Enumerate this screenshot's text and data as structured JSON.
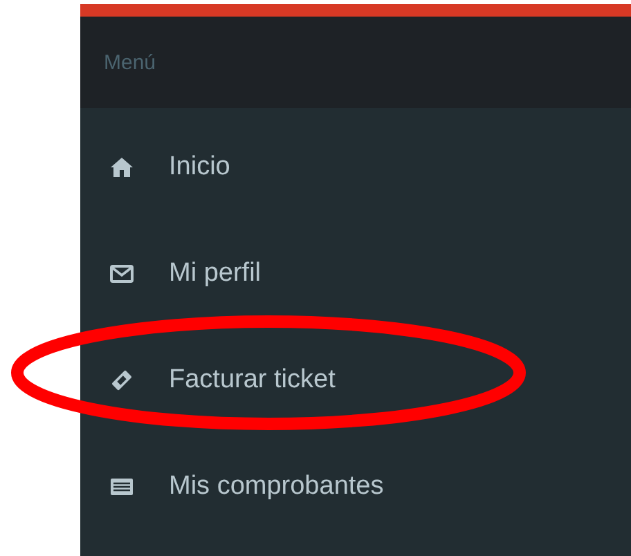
{
  "sidebar": {
    "header": "Menú",
    "items": [
      {
        "label": "Inicio",
        "circled": false
      },
      {
        "label": "Mi perfil",
        "circled": false
      },
      {
        "label": "Facturar ticket",
        "circled": true
      },
      {
        "label": "Mis comprobantes",
        "circled": false
      }
    ]
  }
}
